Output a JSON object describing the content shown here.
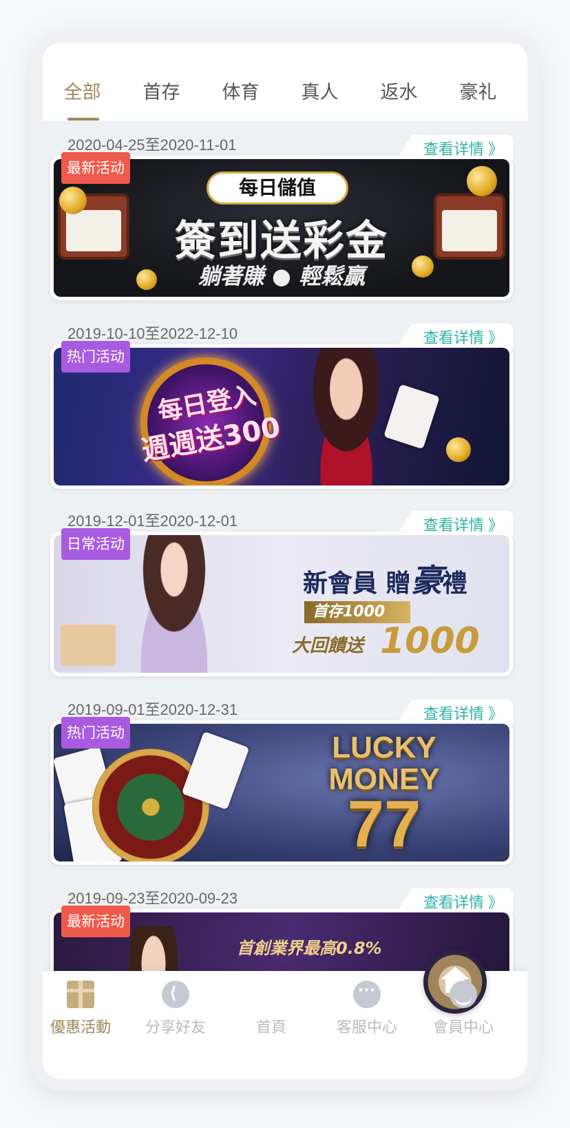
{
  "tabs": [
    {
      "label": "全部",
      "active": true
    },
    {
      "label": "首存",
      "active": false
    },
    {
      "label": "体育",
      "active": false
    },
    {
      "label": "真人",
      "active": false
    },
    {
      "label": "返水",
      "active": false
    },
    {
      "label": "豪礼",
      "active": false
    }
  ],
  "detail_label": "查看详情",
  "detail_chevron": "》",
  "promotions": [
    {
      "date_range": "2020-04-25至2020-11-01",
      "badge": "最新活动",
      "badge_color": "#f05a4a",
      "banner": {
        "pill": "每日儲值",
        "headline": "簽到送彩金",
        "subline": "躺著賺 ● 輕鬆贏"
      }
    },
    {
      "date_range": "2019-10-10至2022-12-10",
      "badge": "热门活动",
      "badge_color": "#a85be0",
      "banner": {
        "line1": "每日登入",
        "line2": "週週送300"
      }
    },
    {
      "date_range": "2019-12-01至2020-12-01",
      "badge": "日常活动",
      "badge_color": "#a85be0",
      "banner": {
        "headline_a": "新會員",
        "headline_b": "贈",
        "headline_c": "豪",
        "headline_d": "禮",
        "line2": "首存1000",
        "line3a": "大回饋送",
        "line3b": "1000"
      }
    },
    {
      "date_range": "2019-09-01至2020-12-31",
      "badge": "热门活动",
      "badge_color": "#a85be0",
      "banner": {
        "line1": "LUCKY",
        "line2": "MONEY",
        "line3": "77"
      }
    },
    {
      "date_range": "2019-09-23至2020-09-23",
      "badge": "最新活动",
      "badge_color": "#f05a4a",
      "banner": {
        "line1": "首創業界最高0.8%"
      }
    }
  ],
  "bottom_nav": [
    {
      "label": "優惠活動",
      "icon": "gift-icon",
      "active": true
    },
    {
      "label": "分享好友",
      "icon": "share-icon",
      "active": false
    },
    {
      "label": "首頁",
      "icon": "home-icon",
      "active": false
    },
    {
      "label": "客服中心",
      "icon": "chat-icon",
      "active": false
    },
    {
      "label": "會員中心",
      "icon": "user-icon",
      "active": false
    }
  ],
  "colors": {
    "accent": "#a0885a",
    "detail": "#2eb3a8",
    "background": "#eef1f4"
  }
}
